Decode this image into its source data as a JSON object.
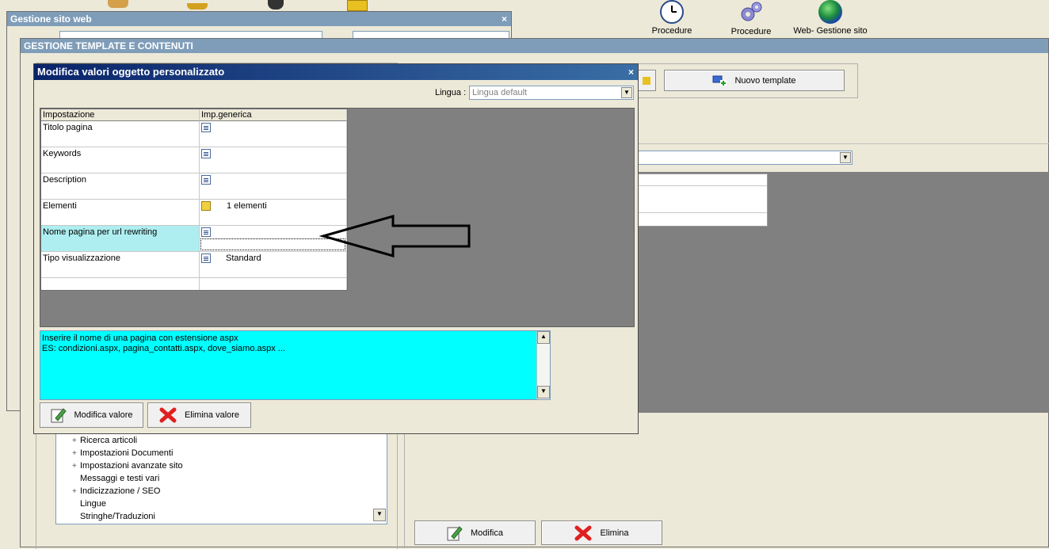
{
  "colors": {
    "dialog_title": "#0a246a",
    "hint_bg": "#00ffff",
    "selected_cell": "#aeeef0",
    "gray_area": "#808080"
  },
  "toolbar": {
    "items": [
      {
        "label": "Procedure",
        "icon": "clock-icon"
      },
      {
        "label": "Procedure",
        "icon": "gears-icon"
      },
      {
        "label": "Web- Gestione sito",
        "icon": "globe-icon"
      }
    ]
  },
  "win_sito": {
    "title": "Gestione sito web",
    "close": "×"
  },
  "win_template": {
    "title": "GESTIONE TEMPLATE E CONTENUTI",
    "new_template": "Nuovo template",
    "modify": "Modifica",
    "delete": "Elimina",
    "tree": [
      {
        "label": "Ricerca articoli",
        "expand": "+"
      },
      {
        "label": "Impostazioni Documenti",
        "expand": "+"
      },
      {
        "label": "Impostazioni avanzate sito",
        "expand": "+"
      },
      {
        "label": "Messaggi e testi vari",
        "expand": ""
      },
      {
        "label": "Indicizzazione / SEO",
        "expand": "+"
      },
      {
        "label": "Lingue",
        "expand": ""
      },
      {
        "label": "Stringhe/Traduzioni",
        "expand": ""
      }
    ]
  },
  "dialog": {
    "title": "Modifica valori oggetto personalizzato",
    "close": "×",
    "lingua_label": "Lingua :",
    "lingua_value": "Lingua default",
    "grid_headers": [
      "Impostazione",
      "Imp.generica"
    ],
    "rows": [
      {
        "name": "Titolo pagina",
        "value": ""
      },
      {
        "name": "Keywords",
        "value": ""
      },
      {
        "name": "Description",
        "value": ""
      },
      {
        "name": "Elementi",
        "value": "1 elementi"
      },
      {
        "name": "Nome pagina per url rewriting",
        "value": ""
      },
      {
        "name": "Tipo visualizzazione",
        "value": "Standard"
      }
    ],
    "hint_line1": "Inserire il nome di una pagina con estensione aspx",
    "hint_line2": "ES: condizioni.aspx, pagina_contatti.aspx, dove_siamo.aspx ...",
    "modify_value": "Modifica valore",
    "delete_value": "Elimina valore"
  }
}
